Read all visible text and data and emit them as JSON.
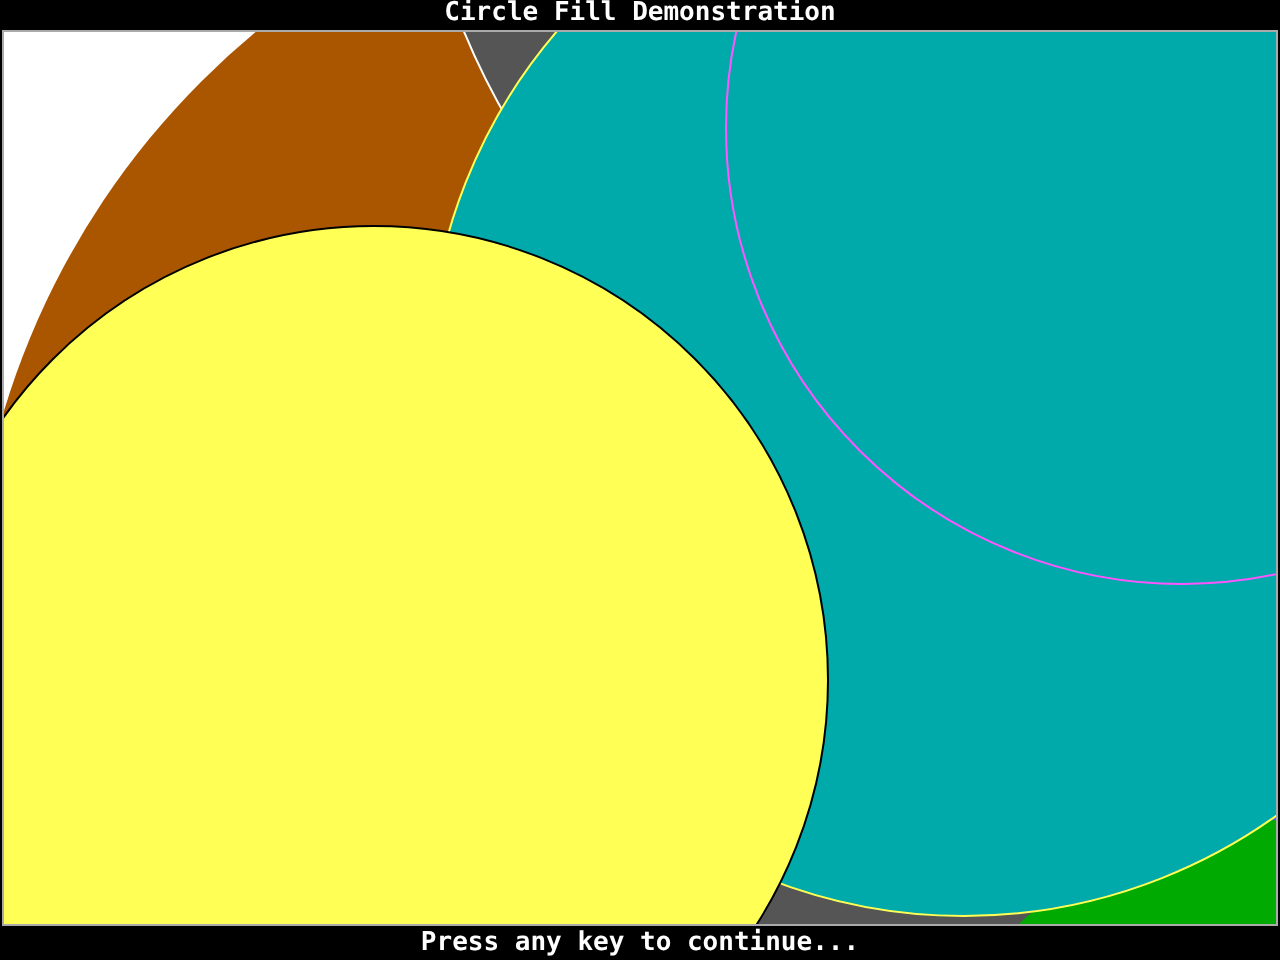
{
  "title_bar": {
    "title": "Circle Fill Demonstration"
  },
  "status_bar": {
    "message": "Press any key to continue..."
  }
}
